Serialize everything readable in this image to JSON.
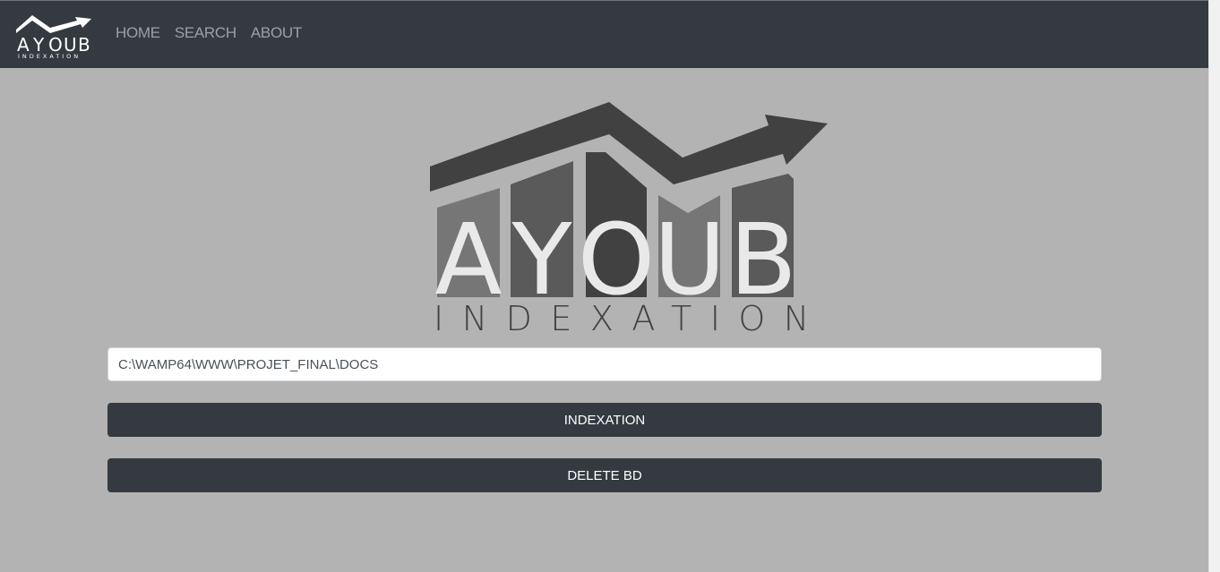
{
  "nav": {
    "brand": {
      "letters": [
        "A",
        "Y",
        "O",
        "U",
        "B"
      ],
      "subtitle": "INDEXATION"
    },
    "links": [
      {
        "label": "HOME"
      },
      {
        "label": "SEARCH"
      },
      {
        "label": "ABOUT"
      }
    ]
  },
  "hero": {
    "logo_letters": [
      "A",
      "Y",
      "O",
      "U",
      "B"
    ],
    "logo_subtitle": "INDEXATION"
  },
  "form": {
    "path_value": "C:\\WAMP64\\WWW\\PROJET_FINAL\\DOCS",
    "index_button": "INDEXATION",
    "delete_button": "DELETE BD"
  },
  "colors": {
    "navbar": "#343a40",
    "page_background": "#b3b3b3",
    "button": "#343a40"
  }
}
